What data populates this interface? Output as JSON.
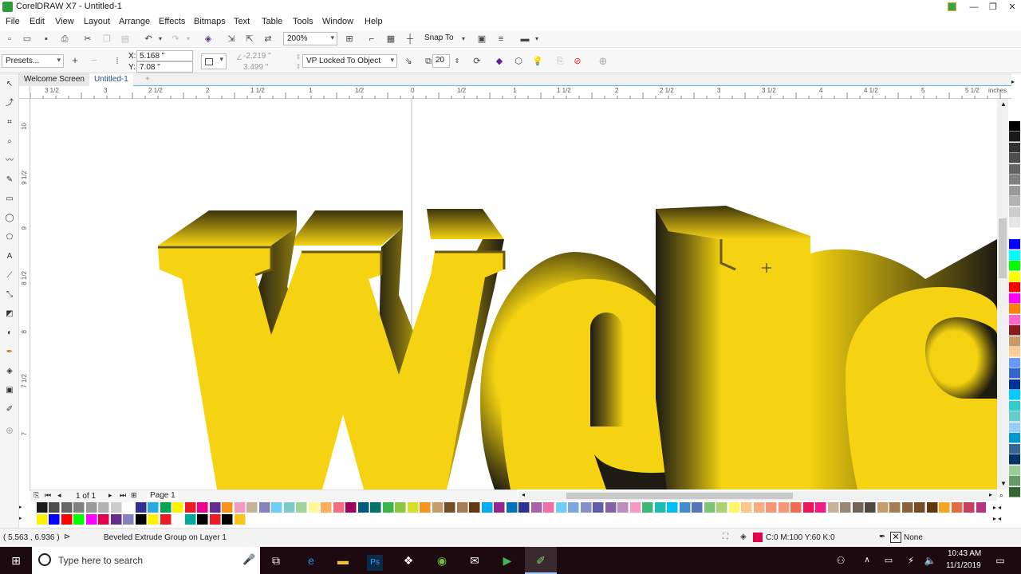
{
  "window": {
    "title": "CorelDRAW X7 - Untitled-1",
    "min": "—",
    "restore": "❐",
    "close": "✕"
  },
  "menu": [
    "File",
    "Edit",
    "View",
    "Layout",
    "Arrange",
    "Effects",
    "Bitmaps",
    "Text",
    "Table",
    "Tools",
    "Window",
    "Help"
  ],
  "toolbar": {
    "zoom": "200%",
    "snap_to": "Snap To"
  },
  "property_bar": {
    "presets": "Presets...",
    "x_label": "X:",
    "x_value": "5.168 \"",
    "y_label": "Y:",
    "y_value": "7.08 \"",
    "vp_x": "-2.219 \"",
    "vp_y": "3.499 \"",
    "vp_mode": "VP Locked To Object",
    "depth": "20"
  },
  "tabs": [
    "Welcome Screen",
    "Untitled-1"
  ],
  "ruler": {
    "h_labels": [
      "3 1/2",
      "3",
      "2 1/2",
      "2",
      "1 1/2",
      "1",
      "1/2",
      "0",
      "1/2",
      "1",
      "1 1/2",
      "2",
      "2 1/2",
      "3",
      "3 1/2",
      "4",
      "4 1/2",
      "5",
      "5 1/2"
    ],
    "h_units": "inches",
    "v_labels": [
      "10",
      "9 1/2",
      "9",
      "8 1/2",
      "8",
      "7 1/2",
      "7"
    ]
  },
  "artwork": {
    "text": "Welc",
    "fill": "#f5d312"
  },
  "page_nav": {
    "page_count": "1 of 1",
    "page_tab": "Page 1"
  },
  "status": {
    "coords": "( 5.563 , 6.936 )",
    "object_info": "Beveled Extrude Group on Layer 1",
    "fill_info": "C:0 M:100 Y:60 K:0",
    "outline_info": "None",
    "fill_color": "#e3004f"
  },
  "taskbar": {
    "search_placeholder": "Type here to search",
    "time": "10:43 AM",
    "date": "11/1/2019"
  },
  "palette_row1": [
    "#ffffff",
    "#1a1a1a",
    "#4d4d4d",
    "#666",
    "#808080",
    "#999",
    "#b3b3b3",
    "#ccc",
    "#fff",
    "#2e3192",
    "#29abe2",
    "#00a651",
    "#fff200",
    "#ed1c24",
    "#ec008c",
    "#662d91",
    "#f7941d",
    "#f49ac1",
    "#c7b299",
    "#8781bd",
    "#6dcff6",
    "#7accc8",
    "#a3d39c",
    "#fff799",
    "#fbaf5d",
    "#f26d7d",
    "#9e005d",
    "#005b7f",
    "#00746b",
    "#39b54a",
    "#8dc63f",
    "#d7df23",
    "#f7941d",
    "#c69c6d",
    "#754c24",
    "#a67c52",
    "#603913",
    "#00aeef",
    "#92278f",
    "#0072bc",
    "#2e3192",
    "#a864a8",
    "#f06eaa",
    "#6dcff6",
    "#7da7d9",
    "#8393ca",
    "#605ca8",
    "#855fa8",
    "#bd8cbf",
    "#f49ac2",
    "#3cb878",
    "#1cbbb4",
    "#00bff3",
    "#448ccb",
    "#5674b9",
    "#7cc576",
    "#acd373",
    "#fff568",
    "#fdc689",
    "#f9ad81",
    "#f69679",
    "#f7977a",
    "#f26c4f",
    "#ed145b",
    "#ee1d88",
    "#c7b299",
    "#998675",
    "#736357",
    "#534741",
    "#c69c6d",
    "#a67c52",
    "#8c6239",
    "#754c24",
    "#603913",
    "#f5a623",
    "#e36c45",
    "#c7415e",
    "#b83280"
  ],
  "palette_row2": [
    "#ffffff",
    "#fff200",
    "#0000ff",
    "#ff0000",
    "#00ff00",
    "#ff00ff",
    "#e3004f",
    "#662d91",
    "#8781bd",
    "#000",
    "#fff200",
    "#ed1c24",
    "#ffffff",
    "#00a99d",
    "#000",
    "#ed1c24",
    "#000",
    "#f7c41a"
  ],
  "palette_v": [
    "#ffffff",
    "#000000",
    "#1a1a1a",
    "#333",
    "#4d4d4d",
    "#666",
    "#808080",
    "#999",
    "#b3b3b3",
    "#ccc",
    "#e6e6e6",
    "#ffffff",
    "#0000ff",
    "#00ffff",
    "#00ff00",
    "#ffff00",
    "#ff0000",
    "#ff00ff",
    "#ff7f00",
    "#ff66cc",
    "#8b1a1a",
    "#cc9966",
    "#ffcc99",
    "#6699ff",
    "#3366cc",
    "#003399",
    "#00ccff",
    "#33cccc",
    "#66cccc",
    "#99ccff",
    "#0099cc",
    "#336699",
    "#003366",
    "#99cc99",
    "#669966",
    "#336633"
  ]
}
